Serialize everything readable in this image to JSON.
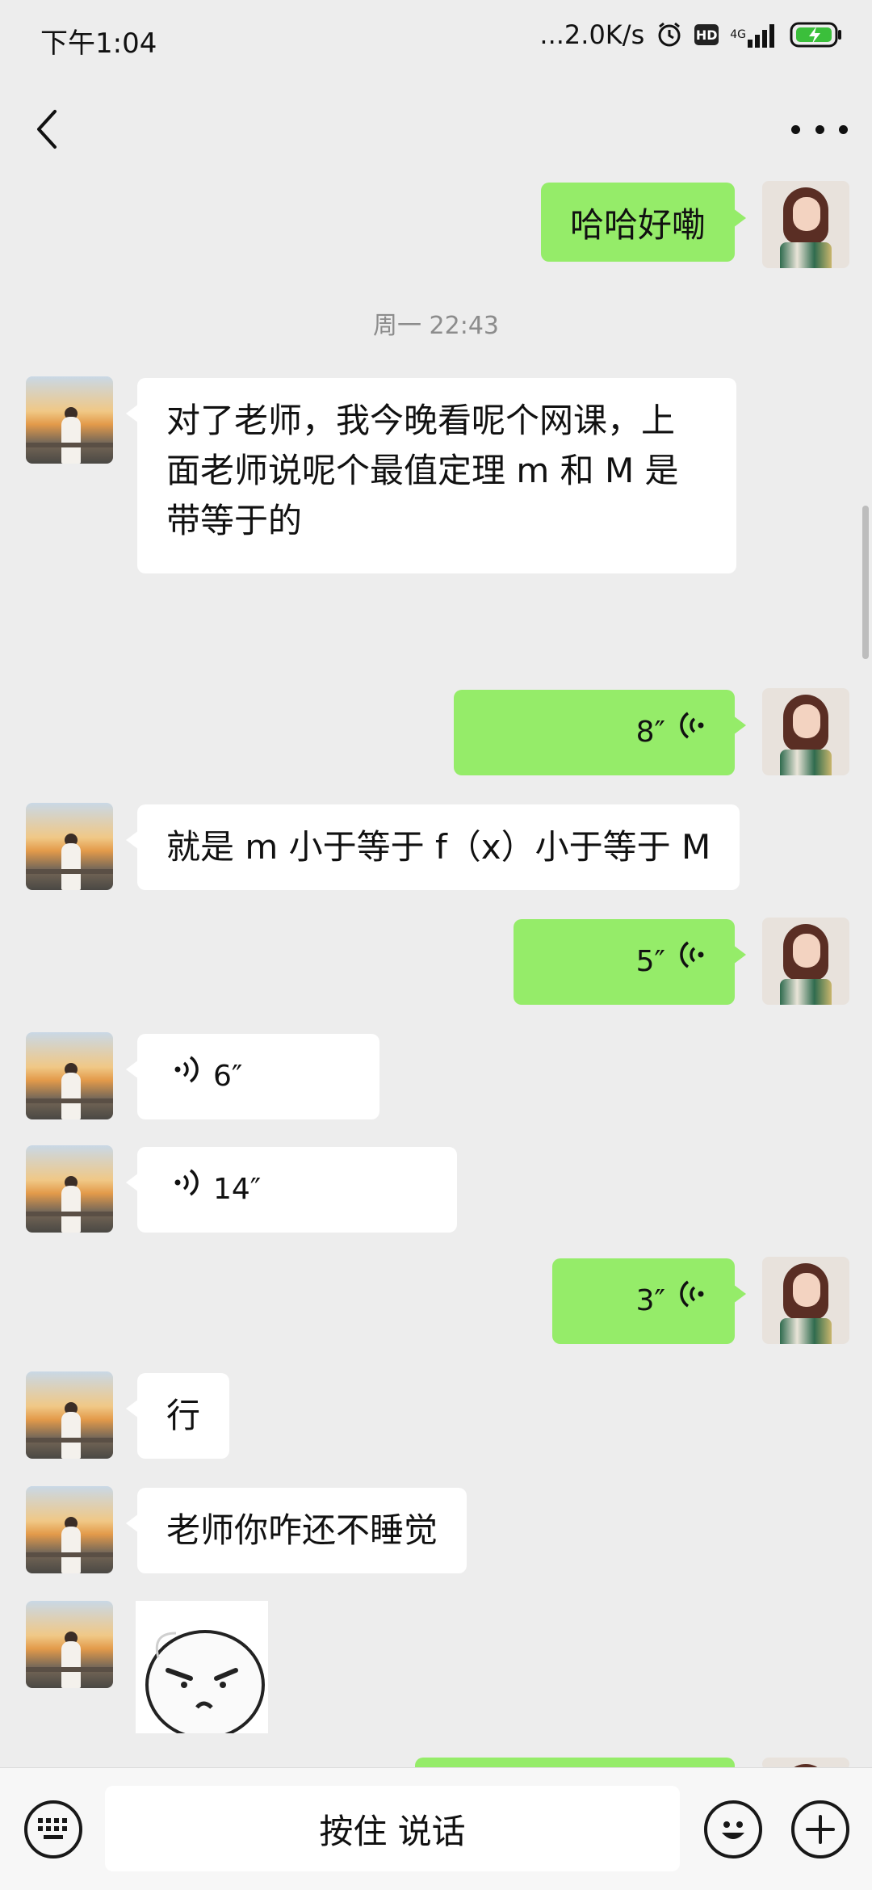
{
  "status_bar": {
    "time": "下午1:04",
    "network_speed": "...2.0K/s",
    "icons": [
      "alarm-icon",
      "hd-icon",
      "4g-signal-icon",
      "battery-charging-icon"
    ],
    "hd_label": "HD",
    "net_label": "4G",
    "battery_level_label": ""
  },
  "title_bar": {
    "back_icon": "chevron-left-icon",
    "more_icon": "more-dots-icon"
  },
  "messages": [
    {
      "side": "right",
      "type": "text",
      "text": "哈哈好嘞"
    },
    {
      "side": "center",
      "type": "time",
      "text": "周一 22:43"
    },
    {
      "side": "left",
      "type": "text",
      "lines": [
        "对了老师，我今晚看呢个网课，上",
        "面老师说呢个最值定理 m 和 M 是",
        "带等于的"
      ]
    },
    {
      "side": "right",
      "type": "voice",
      "duration": "8″"
    },
    {
      "side": "left",
      "type": "text",
      "text": "就是 m 小于等于 f（x）小于等于 M"
    },
    {
      "side": "right",
      "type": "voice",
      "duration": "5″"
    },
    {
      "side": "left",
      "type": "voice",
      "duration": "6″"
    },
    {
      "side": "left",
      "type": "voice",
      "duration": "14″"
    },
    {
      "side": "right",
      "type": "voice",
      "duration": "3″"
    },
    {
      "side": "left",
      "type": "text",
      "text": "行"
    },
    {
      "side": "left",
      "type": "text",
      "text": "老师你咋还不睡觉"
    },
    {
      "side": "left",
      "type": "sticker",
      "icon": "angry-face-sticker-icon"
    }
  ],
  "bottom_bar": {
    "hold_to_talk": "按住 说话",
    "keyboard_icon": "keyboard-icon",
    "emoji_icon": "emoji-icon",
    "plus_icon": "plus-icon"
  },
  "colors": {
    "background": "#ededed",
    "bubble_right": "#95ec69",
    "bubble_left": "#ffffff",
    "timestamp_text": "#8c8c8c"
  }
}
